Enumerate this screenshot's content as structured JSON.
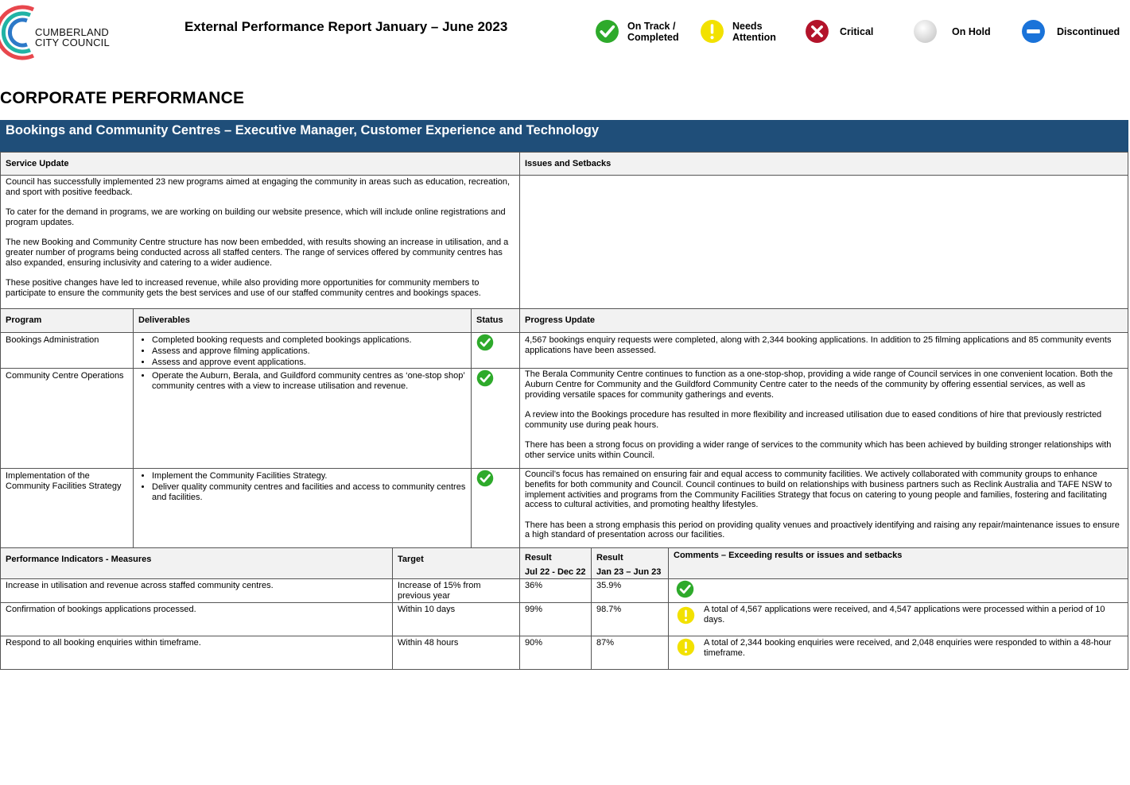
{
  "header": {
    "logo_line1": "CUMBERLAND",
    "logo_line2": "CITY COUNCIL",
    "report_title": "External Performance Report January – June 2023",
    "legend": [
      {
        "icon": "check-icon",
        "line1": "On Track /",
        "line2": "Completed",
        "color": "#2eaa2b"
      },
      {
        "icon": "exclamation-icon",
        "line1": "Needs",
        "line2": "Attention",
        "color": "#f2e100"
      },
      {
        "icon": "cross-icon",
        "line1": "Critical",
        "line2": "",
        "color": "#b3132a"
      },
      {
        "icon": "hold-icon",
        "line1": "On Hold",
        "line2": "",
        "color": "#e6e6e6"
      },
      {
        "icon": "minus-icon",
        "line1": "Discontinued",
        "line2": "",
        "color": "#1a73d9"
      }
    ]
  },
  "section_title": "CORPORATE PERFORMANCE",
  "banner": "Bookings and Community Centres – Executive Manager, Customer Experience and Technology",
  "service_update": {
    "heading": "Service Update",
    "paragraphs": [
      "Council has successfully implemented 23 new programs aimed at engaging the community in areas such as education, recreation, and sport with positive feedback.",
      "To cater for the demand in programs, we are working on building our website presence, which will include online registrations and program updates.",
      "The new Booking and Community Centre structure has now been embedded, with results showing an increase in utilisation, and a greater number of programs being conducted across all staffed centers. The range of services offered by community centres has also expanded, ensuring inclusivity and catering to a wider audience.",
      "These positive changes have led to increased revenue, while also providing more opportunities for community members to participate to ensure the community gets the best services and use of our staffed community centres and bookings spaces."
    ]
  },
  "issues": {
    "heading": "Issues and Setbacks"
  },
  "programs_table": {
    "headers": {
      "program": "Program",
      "deliverables": "Deliverables",
      "status": "Status",
      "progress": "Progress Update"
    },
    "rows": [
      {
        "program": "Bookings Administration",
        "deliverables": [
          "Completed booking requests and completed bookings applications.",
          "Assess and approve filming applications.",
          "Assess and approve event applications."
        ],
        "status": "check-icon",
        "progress": [
          "4,567 bookings enquiry requests were completed, along with 2,344 booking applications. In addition to 25 filming applications and 85 community events applications have been assessed."
        ]
      },
      {
        "program": "Community Centre Operations",
        "deliverables": [
          "Operate the Auburn, Berala, and Guildford community centres as ‘one-stop shop’ community centres with a view to increase utilisation and revenue."
        ],
        "status": "check-icon",
        "progress": [
          "The Berala Community Centre continues to function as a one-stop-shop, providing a wide range of Council services in one convenient location. Both the Auburn Centre for Community and the Guildford Community Centre cater to the needs of the community by offering essential services, as well as providing versatile spaces for community gatherings and events.",
          "A review into the Bookings procedure has resulted in more flexibility and increased utilisation due to eased conditions of hire that previously restricted community use during peak hours.",
          "There has been a strong focus on providing a wider range of services to the community which has been achieved by building stronger relationships with other service units within Council."
        ]
      },
      {
        "program": "Implementation of the Community Facilities Strategy",
        "deliverables": [
          "Implement the Community Facilities Strategy.",
          "Deliver quality community centres and facilities and access to community centres and facilities."
        ],
        "status": "check-icon",
        "progress": [
          "Council’s focus has remained on ensuring fair and equal access to community facilities. We actively collaborated with community groups to enhance benefits for both community and Council. Council continues to build on relationships with business partners such as Reclink Australia and TAFE NSW to implement activities and programs from the Community Facilities Strategy that focus on catering to young people and families, fostering and facilitating access to cultural activities, and promoting healthy lifestyles.",
          "There has been a strong emphasis this period on providing quality venues and proactively identifying and raising any repair/maintenance issues to ensure a high standard of presentation across our facilities."
        ]
      }
    ]
  },
  "kpi_table": {
    "headers": {
      "measure": "Performance Indicators - Measures",
      "target": "Target",
      "result1": "Result",
      "result1_period": "Jul 22 - Dec 22",
      "result2": "Result",
      "result2_period": "Jan 23 – Jun 23",
      "comments": "Comments – Exceeding results or issues and setbacks"
    },
    "rows": [
      {
        "measure": "Increase in utilisation and revenue across staffed community centres.",
        "target": "Increase of 15% from previous year",
        "result1": "36%",
        "result2": "35.9%",
        "status": "check-icon",
        "comment": ""
      },
      {
        "measure": "Confirmation of bookings applications processed.",
        "target": "Within 10 days",
        "result1": "99%",
        "result2": "98.7%",
        "status": "exclamation-icon",
        "comment": "A total of 4,567 applications were received, and 4,547 applications were processed within a period of 10 days."
      },
      {
        "measure": "Respond to all booking enquiries within timeframe.",
        "target": "Within 48 hours",
        "result1": "90%",
        "result2": "87%",
        "status": "exclamation-icon",
        "comment": "A total of 2,344 booking enquiries were received, and 2,048 enquiries were responded to within a 48-hour timeframe."
      }
    ]
  }
}
